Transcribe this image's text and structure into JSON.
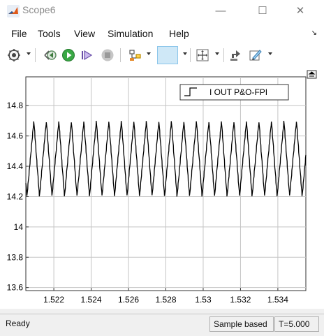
{
  "window": {
    "title": "Scope6",
    "minimize": "—",
    "maximize": "☐",
    "close": "✕"
  },
  "menu": {
    "items": [
      "File",
      "Tools",
      "View",
      "Simulation",
      "Help"
    ]
  },
  "toolbar": {
    "buttons": [
      "settings",
      "step-back",
      "run",
      "step-forward",
      "stop",
      "highlight-simulink-block",
      "zoom-in",
      "autoscale",
      "signal-selector",
      "edit-style"
    ]
  },
  "legend": {
    "label": "I OUT P&O-FPI"
  },
  "chart_data": {
    "type": "line",
    "series": [
      {
        "name": "I OUT P&O-FPI",
        "color": "#000000"
      }
    ],
    "x_ticks": [
      "1.522",
      "1.524",
      "1.526",
      "1.528",
      "1.53",
      "1.532",
      "1.534"
    ],
    "y_ticks": [
      "13.6",
      "13.8",
      "14",
      "14.2",
      "14.4",
      "14.6",
      "14.8"
    ],
    "xlim": [
      1.5205,
      1.5355
    ],
    "ylim": [
      13.58,
      14.99
    ],
    "signal": {
      "min": 14.2,
      "max": 14.7,
      "period": 0.00067,
      "phase_start": 1.52055
    },
    "grid": true
  },
  "status": {
    "left": "Ready",
    "mode": "Sample based",
    "time": "T=5.000"
  }
}
